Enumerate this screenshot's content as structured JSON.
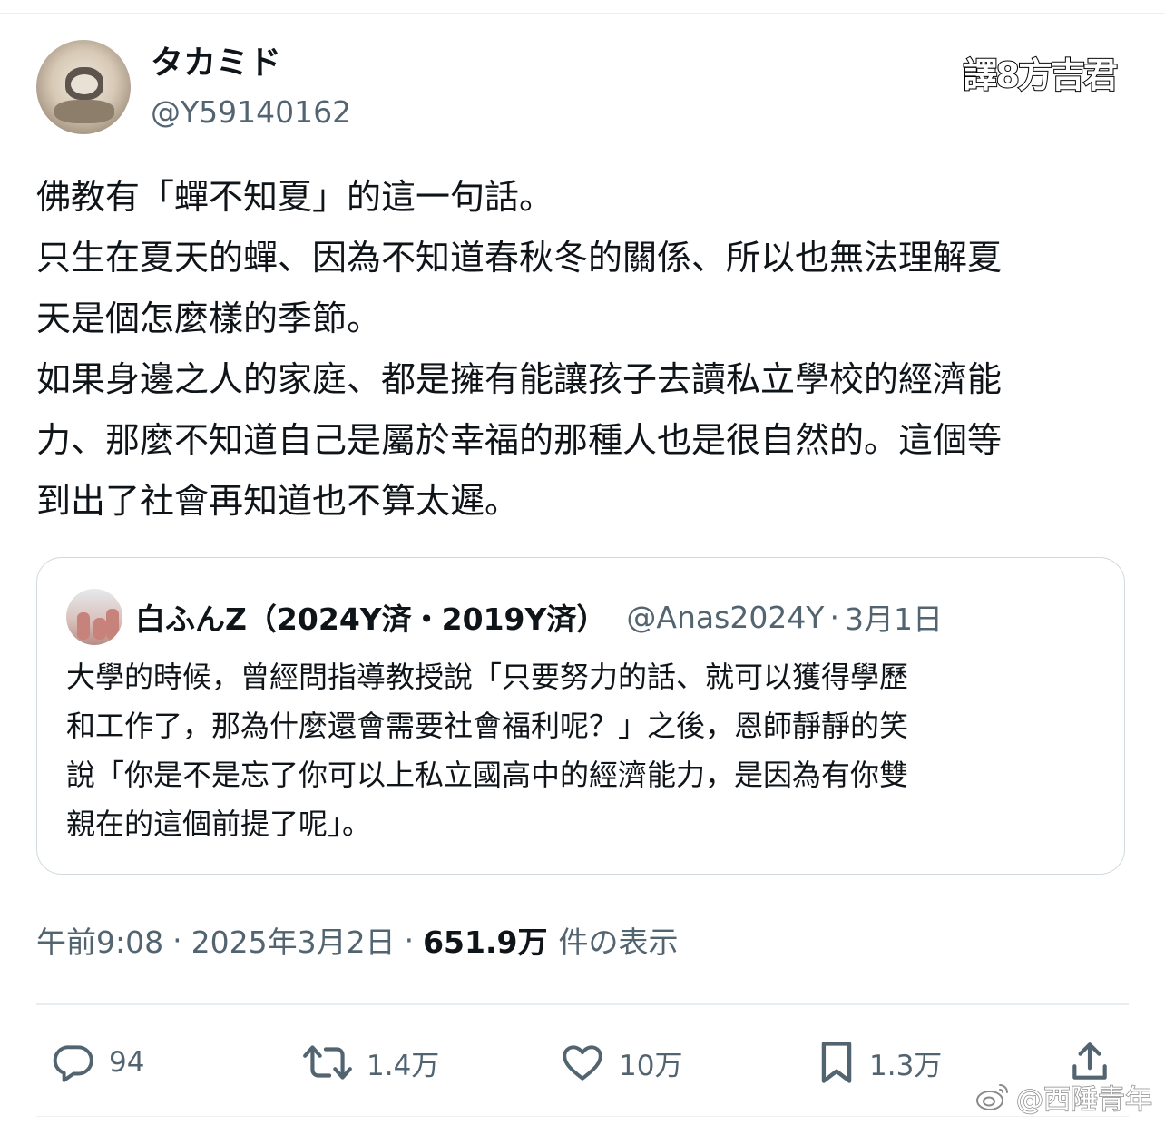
{
  "author": {
    "display_name": "タカミド",
    "handle": "@Y59140162"
  },
  "watermark_top": "譯8方吉君",
  "tweet": {
    "lines": [
      "佛教有「蟬不知夏」的這一句話。",
      "只生在夏天的蟬、因為不知道春秋冬的關係、所以也無法理解夏",
      "天是個怎麼樣的季節。",
      "如果身邊之人的家庭、都是擁有能讓孩子去讀私立學校的經濟能",
      "力、那麼不知道自己是屬於幸福的那種人也是很自然的。這個等",
      "到出了社會再知道也不算太遲。"
    ]
  },
  "quote": {
    "display_name": "白ふんZ（2024Y済・2019Y済）",
    "handle": "@Anas2024Y",
    "separator": "·",
    "date": "3月1日",
    "lines": [
      "大學的時候，曾經問指導教授說「只要努力的話、就可以獲得學歷",
      "和工作了，那為什麼還會需要社會福利呢？」之後，恩師靜靜的笑",
      "說「你是不是忘了你可以上私立國高中的經濟能力，是因為有你雙",
      "親在的這個前提了呢」。"
    ]
  },
  "meta": {
    "time": "午前9:08",
    "separator": "·",
    "date": "2025年3月2日",
    "views_count": "651.9万",
    "views_label": "件の表示"
  },
  "actions": {
    "reply": {
      "icon": "reply-icon",
      "count": "94"
    },
    "repost": {
      "icon": "repost-icon",
      "count": "1.4万"
    },
    "like": {
      "icon": "heart-icon",
      "count": "10万"
    },
    "bookmark": {
      "icon": "bookmark-icon",
      "count": "1.3万"
    },
    "share": {
      "icon": "share-icon"
    }
  },
  "watermark_bottom": "@西陲青年",
  "colors": {
    "text": "#0f1419",
    "secondary": "#536471",
    "border": "#cfd9de"
  }
}
